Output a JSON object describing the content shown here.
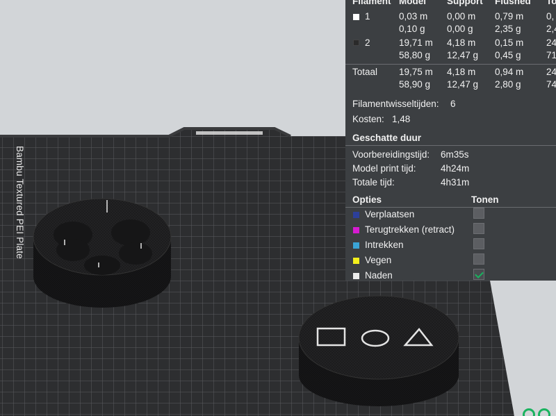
{
  "bed": {
    "label": "Bambu Textured PEI Plate"
  },
  "stats": {
    "columns": [
      "Filament",
      "Model",
      "Support",
      "Flushed",
      "To"
    ],
    "filaments": [
      {
        "id": "1",
        "color": "#ffffff",
        "model_len": "0,03 m",
        "model_wt": "0,10 g",
        "support_len": "0,00 m",
        "support_wt": "0,00 g",
        "flushed_len": "0,79 m",
        "flushed_wt": "2,35 g",
        "total_len": "0,",
        "total_wt": "2,4"
      },
      {
        "id": "2",
        "color": "#2a2a2a",
        "model_len": "19,71 m",
        "model_wt": "58,80 g",
        "support_len": "4,18 m",
        "support_wt": "12,47 g",
        "flushed_len": "0,15 m",
        "flushed_wt": "0,45 g",
        "total_len": "24",
        "total_wt": "71"
      }
    ],
    "total": {
      "label": "Totaal",
      "model_len": "19,75 m",
      "model_wt": "58,90 g",
      "support_len": "4,18 m",
      "support_wt": "12,47 g",
      "flushed_len": "0,94 m",
      "flushed_wt": "2,80 g",
      "total_len": "24",
      "total_wt": "74"
    },
    "filament_changes_label": "Filamentwisseltijden:",
    "filament_changes_value": "6",
    "cost_label": "Kosten:",
    "cost_value": "1,48"
  },
  "duration": {
    "title": "Geschatte duur",
    "rows": [
      {
        "label": "Voorbereidingstijd:",
        "value": "6m35s"
      },
      {
        "label": "Model print tijd:",
        "value": "4h24m"
      },
      {
        "label": "Totale tijd:",
        "value": "4h31m"
      }
    ]
  },
  "options": {
    "title": "Opties",
    "show_title": "Tonen",
    "items": [
      {
        "label": "Verplaatsen",
        "color": "#2c3f9a",
        "checked": false
      },
      {
        "label": "Terugtrekken (retract)",
        "color": "#d61bd1",
        "checked": false
      },
      {
        "label": "Intrekken",
        "color": "#3aa4d6",
        "checked": false
      },
      {
        "label": "Vegen",
        "color": "#f3ef1c",
        "checked": false
      },
      {
        "label": "Naden",
        "color": "#ececec",
        "checked": true
      }
    ]
  }
}
